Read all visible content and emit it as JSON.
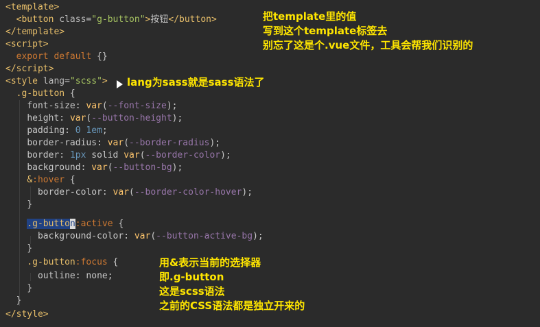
{
  "code": {
    "line1": {
      "open": "<",
      "tag": "template",
      "close": ">"
    },
    "line2": {
      "indent": "  ",
      "open": "<",
      "tag": "button",
      "sp": " ",
      "attr": "class",
      "eq": "=",
      "val": "\"g-button\"",
      "gt": ">",
      "text": "按钮",
      "endopen": "</",
      "endtag": "button",
      "endclose": ">"
    },
    "line3": {
      "open": "</",
      "tag": "template",
      "close": ">"
    },
    "line4": {
      "open": "<",
      "tag": "script",
      "close": ">"
    },
    "line5": {
      "indent": "  ",
      "kw": "export default",
      "rest": " {}"
    },
    "line6": {
      "open": "</",
      "tag": "script",
      "close": ">"
    },
    "line7": {
      "open": "<",
      "tag": "style",
      "sp": " ",
      "attr": "lang",
      "eq": "=",
      "val": "\"scss\"",
      "close": ">"
    },
    "line8": {
      "indent": "  ",
      "sel": ".g-button",
      "rest": " {"
    },
    "line9": {
      "indent": "    ",
      "prop": "font-size: ",
      "fn": "var",
      "lp": "(",
      "var": "--font-size",
      "rp": ");"
    },
    "line10": {
      "indent": "    ",
      "prop": "height: ",
      "fn": "var",
      "lp": "(",
      "var": "--button-height",
      "rp": ");"
    },
    "line11": {
      "indent": "    ",
      "prop": "padding: ",
      "n1": "0",
      "sp": " ",
      "n2": "1em",
      "semi": ";"
    },
    "line12": {
      "indent": "    ",
      "prop": "border-radius: ",
      "fn": "var",
      "lp": "(",
      "var": "--border-radius",
      "rp": ");"
    },
    "line13": {
      "indent": "    ",
      "prop": "border: ",
      "n1": "1px",
      "mid": " solid ",
      "fn": "var",
      "lp": "(",
      "var": "--border-color",
      "rp": ");"
    },
    "line14": {
      "indent": "    ",
      "prop": "background: ",
      "fn": "var",
      "lp": "(",
      "var": "--button-bg",
      "rp": ");"
    },
    "line15": {
      "indent": "    ",
      "amp": "&",
      "pseudo": ":hover",
      "rest": " {"
    },
    "line16": {
      "indent": "      ",
      "prop": "border-color: ",
      "fn": "var",
      "lp": "(",
      "var": "--border-color-hover",
      "rp": ");"
    },
    "line17": {
      "indent": "    ",
      "rest": "}"
    },
    "line18": {
      "indent": "    ",
      "selhl": ".g-butto",
      "caret": "n",
      "pseudo": ":active",
      "rest": " {"
    },
    "line19": {
      "indent": "      ",
      "prop": "background-color: ",
      "fn": "var",
      "lp": "(",
      "var": "--button-active-bg",
      "rp": ");"
    },
    "line20": {
      "indent": "    ",
      "rest": "}"
    },
    "line21": {
      "indent": "    ",
      "sel": ".g-button",
      "pseudo": ":focus",
      "rest": " {"
    },
    "line22": {
      "indent": "      ",
      "prop": "outline: ",
      "val": "none",
      "semi": ";"
    },
    "line23": {
      "indent": "    ",
      "rest": "}"
    },
    "line24": {
      "indent": "  ",
      "rest": "}"
    },
    "line25": {
      "open": "</",
      "tag": "style",
      "close": ">"
    }
  },
  "annotations": {
    "top": [
      "把template里的值",
      "写到这个template标签去",
      "别忘了这是个.vue文件，工具会帮我们识别的"
    ],
    "lang": [
      "lang为sass就是sass语法了"
    ],
    "bottom": [
      "用&表示当前的选择器",
      "即.g-button",
      "这是scss语法",
      "之前的CSS语法都是独立开来的"
    ]
  },
  "colors": {
    "background": "#2b2b2b",
    "annotation": "#ffe600",
    "tag": "#e8bf6a",
    "string": "#a5c261",
    "keyword": "#cc7832",
    "variable": "#9876aa",
    "number": "#6897bb",
    "selection": "#214283"
  }
}
